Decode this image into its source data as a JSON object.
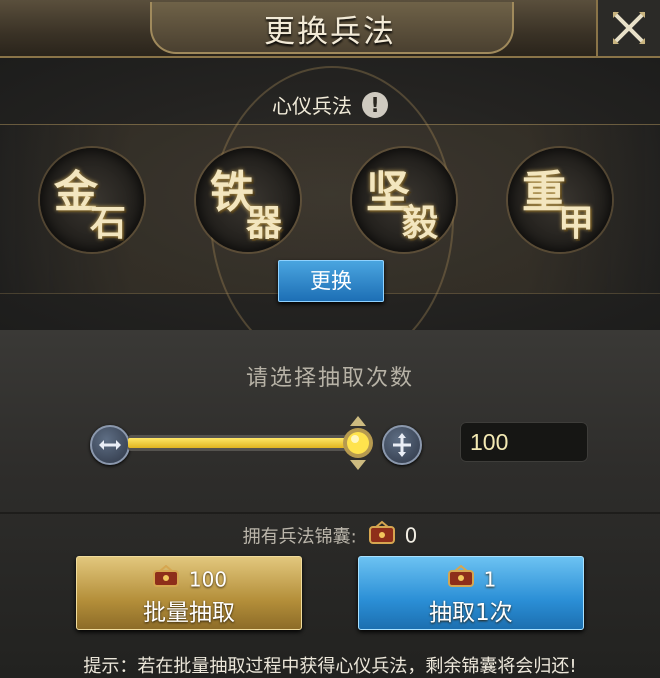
{
  "window": {
    "title": "更换兵法"
  },
  "tactic": {
    "label": "心仪兵法",
    "info": "!",
    "skills": [
      {
        "c1": "金",
        "c2": "石"
      },
      {
        "c1": "铁",
        "c2": "器"
      },
      {
        "c1": "坚",
        "c2": "毅"
      },
      {
        "c1": "重",
        "c2": "甲"
      }
    ],
    "swap_label": "更换"
  },
  "draw": {
    "prompt": "请选择抽取次数",
    "count": "100",
    "slider_fraction": 1.0,
    "owned_label": "拥有兵法锦囊:",
    "owned_count": "0"
  },
  "buttons": {
    "batch": {
      "cost": "100",
      "label": "批量抽取"
    },
    "once": {
      "cost": "1",
      "label": "抽取1次"
    }
  },
  "hint": "提示：若在批量抽取过程中获得心仪兵法，剩余锦囊将会归还!",
  "colors": {
    "accent_gold": "#e0b41f",
    "button_blue": "#2b8fd6",
    "button_gold": "#b48f3a"
  }
}
